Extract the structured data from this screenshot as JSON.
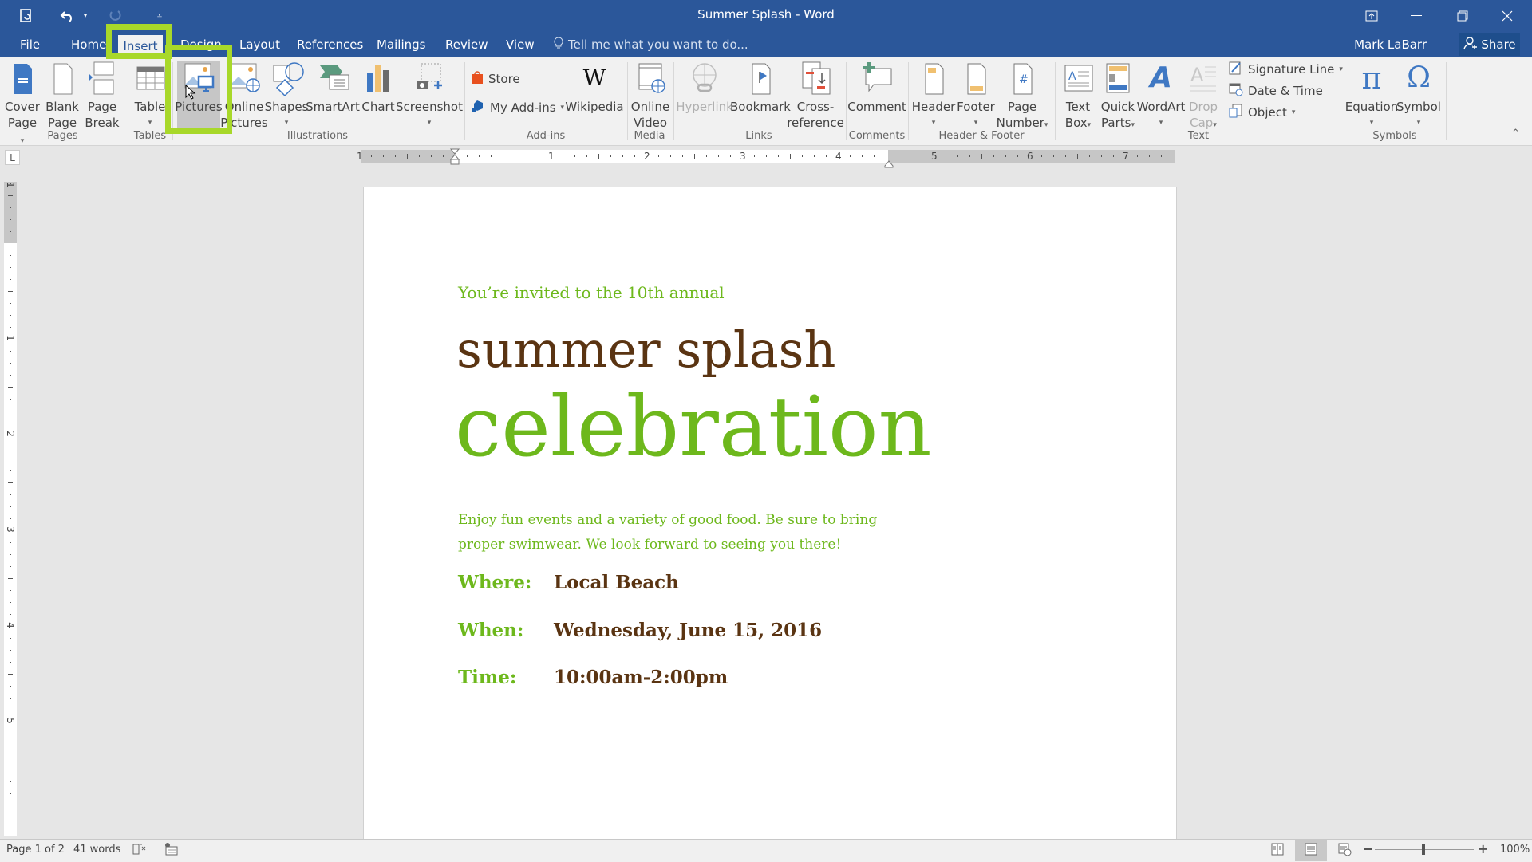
{
  "window": {
    "title": "Summer Splash - Word",
    "user": "Mark LaBarr",
    "share_label": "Share"
  },
  "quick_access": [
    "autosave-icon",
    "undo-icon",
    "redo-icon",
    "customize-icon"
  ],
  "tabs": [
    "File",
    "Home",
    "Insert",
    "Design",
    "Layout",
    "References",
    "Mailings",
    "Review",
    "View"
  ],
  "active_tab": "Insert",
  "tell_me": "Tell me what you want to do...",
  "ribbon": {
    "pages": {
      "label": "Pages",
      "cover": [
        "Cover",
        "Page"
      ],
      "blank": [
        "Blank",
        "Page"
      ],
      "break": [
        "Page",
        "Break"
      ]
    },
    "tables": {
      "label": "Tables",
      "table": "Table"
    },
    "illustrations": {
      "label": "Illustrations",
      "pictures": "Pictures",
      "online_pictures": [
        "Online",
        "Pictures"
      ],
      "shapes": "Shapes",
      "smartart": "SmartArt",
      "chart": "Chart",
      "screenshot": "Screenshot"
    },
    "addins": {
      "label": "Add-ins",
      "store": "Store",
      "my_addins": "My Add-ins",
      "wikipedia": "Wikipedia"
    },
    "media": {
      "label": "Media",
      "online_video": [
        "Online",
        "Video"
      ]
    },
    "links": {
      "label": "Links",
      "hyperlink": "Hyperlink",
      "bookmark": "Bookmark",
      "cross_reference": [
        "Cross-",
        "reference"
      ]
    },
    "comments": {
      "label": "Comments",
      "comment": "Comment"
    },
    "header_footer": {
      "label": "Header & Footer",
      "header": "Header",
      "footer": "Footer",
      "page_number": [
        "Page",
        "Number"
      ]
    },
    "text": {
      "label": "Text",
      "text_box": [
        "Text",
        "Box"
      ],
      "quick_parts": [
        "Quick",
        "Parts"
      ],
      "wordart": "WordArt",
      "drop_cap": [
        "Drop",
        "Cap"
      ],
      "signature_line": "Signature Line",
      "date_time": "Date & Time",
      "object": "Object"
    },
    "symbols": {
      "label": "Symbols",
      "equation": "Equation",
      "symbol": "Symbol"
    }
  },
  "highlight_color": "#a8d82a",
  "ruler": {
    "h_numbers": [
      "1",
      "1",
      "2",
      "3",
      "4",
      "5",
      "6",
      "7"
    ],
    "v_numbers": [
      "1",
      "1",
      "2",
      "3",
      "4",
      "5"
    ],
    "tab_selector": "L"
  },
  "document": {
    "intro": "You’re invited to the 10th annual",
    "title_line1": "summer splash",
    "title_line2": "celebration",
    "body": [
      "Enjoy fun events and a variety of good food. Be sure to bring",
      "proper swimwear. We look forward to seeing you there!"
    ],
    "details": [
      {
        "label": "Where:",
        "value": "Local Beach"
      },
      {
        "label": "When:",
        "value": "Wednesday, June 15, 2016"
      },
      {
        "label": "Time:",
        "value": "10:00am-2:00pm"
      }
    ],
    "colors": {
      "green": "#6db81c",
      "brown": "#5a3412"
    }
  },
  "status": {
    "page": "Page 1 of 2",
    "words": "41 words",
    "zoom": "100%"
  }
}
